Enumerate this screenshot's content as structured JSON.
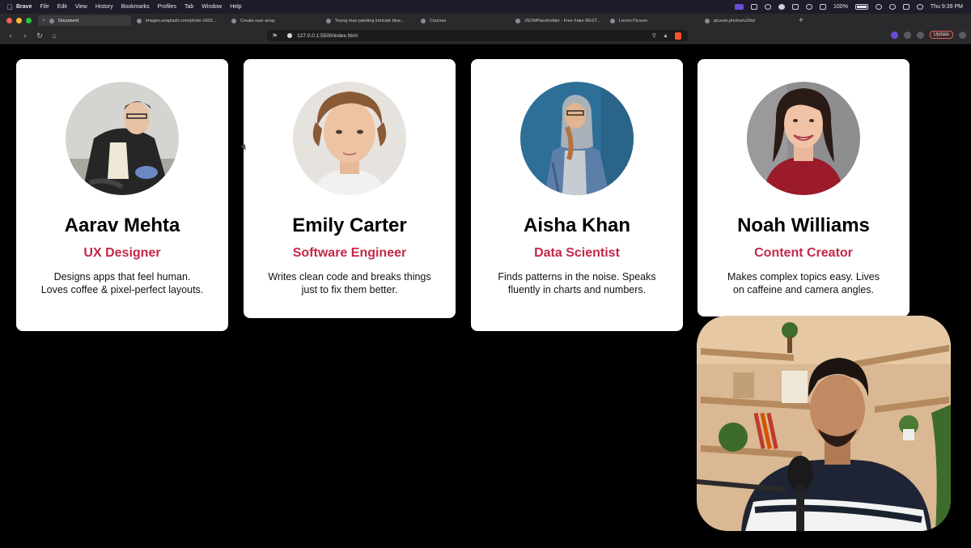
{
  "menubar": {
    "app": "Brave",
    "items": [
      "File",
      "Edit",
      "View",
      "History",
      "Bookmarks",
      "Profiles",
      "Tab",
      "Window",
      "Help"
    ],
    "battery": "100%",
    "clock": "Thu 9:39 PM"
  },
  "tabs": [
    {
      "title": "Document"
    },
    {
      "title": "images.unsplash.com/photo-1603..."
    },
    {
      "title": "Create user array"
    },
    {
      "title": "Young man painting intricate blue..."
    },
    {
      "title": "Courses"
    },
    {
      "title": "JSONPlaceholder - Free Fake REST..."
    },
    {
      "title": "Lorem Picsum"
    },
    {
      "title": "picsum.photos/v2/list"
    }
  ],
  "address": {
    "url": "127.0.0.1:5500/index.html"
  },
  "toolbar": {
    "update_label": "Update"
  },
  "cards": [
    {
      "name": "Aarav Mehta",
      "role": "UX Designer",
      "bio": "Designs apps that feel human. Loves coffee & pixel-perfect layouts."
    },
    {
      "name": "Emily Carter",
      "role": "Software Engineer",
      "bio": "Writes clean code and breaks things just to fix them better."
    },
    {
      "name": "Aisha Khan",
      "role": "Data Scientist",
      "bio": "Finds patterns in the noise. Speaks fluently in charts and numbers."
    },
    {
      "name": "Noah Williams",
      "role": "Content Creator",
      "bio": "Makes complex topics easy. Lives on caffeine and camera angles."
    }
  ],
  "colors": {
    "role_accent": "#c4274a",
    "page_background": "#000000",
    "card_background": "#ffffff"
  }
}
